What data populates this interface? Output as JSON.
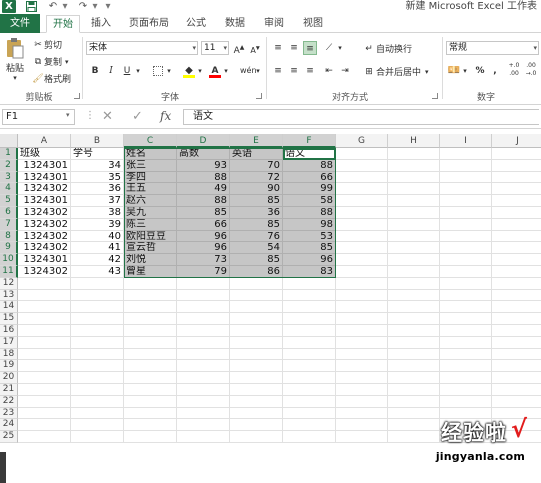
{
  "titlebar": {
    "app_logo": "X",
    "window_title": "新建 Microsoft Excel 工作表"
  },
  "tabs": [
    {
      "label": "文件"
    },
    {
      "label": "开始"
    },
    {
      "label": "插入"
    },
    {
      "label": "页面布局"
    },
    {
      "label": "公式"
    },
    {
      "label": "数据"
    },
    {
      "label": "审阅"
    },
    {
      "label": "视图"
    }
  ],
  "ribbon": {
    "clipboard": {
      "paste": "粘贴",
      "cut": "剪切",
      "copy": "复制",
      "format_painter": "格式刷",
      "group_label": "剪贴板"
    },
    "font": {
      "font_name": "宋体",
      "font_size": "11",
      "group_label": "字体"
    },
    "alignment": {
      "wrap_text": "自动换行",
      "merge_center": "合并后居中",
      "group_label": "对齐方式"
    },
    "number": {
      "format": "常规",
      "percent": "%",
      "comma": ",",
      "inc_decimal": "+.0\n.00",
      "dec_decimal": ".00\n→.0",
      "group_label": "数字"
    },
    "colors": {
      "accent": "#217346",
      "fill_swatch": "#ffff00",
      "font_swatch": "#ff0000"
    }
  },
  "formula_bar": {
    "name_box": "F1",
    "cancel": "✕",
    "enter": "✓",
    "fx": "fx",
    "value": "语文"
  },
  "sheet": {
    "columns": [
      "A",
      "B",
      "C",
      "D",
      "E",
      "F",
      "G",
      "H",
      "I",
      "J"
    ],
    "row_numbers": [
      "1",
      "2",
      "3",
      "4",
      "5",
      "6",
      "7",
      "8",
      "9",
      "10",
      "11",
      "12",
      "13",
      "14",
      "15",
      "16",
      "17",
      "18",
      "19",
      "20",
      "21",
      "22",
      "23",
      "24",
      "25"
    ],
    "selected_columns": [
      "C",
      "D",
      "E",
      "F"
    ],
    "active_cell": "F1",
    "header_row": [
      "班级",
      "学号",
      "姓名",
      "高数",
      "英语",
      "语文"
    ],
    "rows": [
      [
        "1324301",
        "34",
        "张三",
        "93",
        "70",
        "88"
      ],
      [
        "1324301",
        "35",
        "李四",
        "88",
        "72",
        "66"
      ],
      [
        "1324302",
        "36",
        "王五",
        "49",
        "90",
        "99"
      ],
      [
        "1324301",
        "37",
        "赵六",
        "88",
        "85",
        "58"
      ],
      [
        "1324302",
        "38",
        "吴九",
        "85",
        "36",
        "88"
      ],
      [
        "1324302",
        "39",
        "陈三",
        "66",
        "85",
        "98"
      ],
      [
        "1324302",
        "40",
        "欧阳豆豆",
        "96",
        "76",
        "53"
      ],
      [
        "1324302",
        "41",
        "宣云哲",
        "96",
        "54",
        "85"
      ],
      [
        "1324301",
        "42",
        "刘悦",
        "73",
        "85",
        "96"
      ],
      [
        "1324302",
        "43",
        "曾星",
        "79",
        "86",
        "83"
      ]
    ]
  },
  "watermark": {
    "text": "经验啦",
    "check": "√",
    "url": "jingyanla.com"
  }
}
